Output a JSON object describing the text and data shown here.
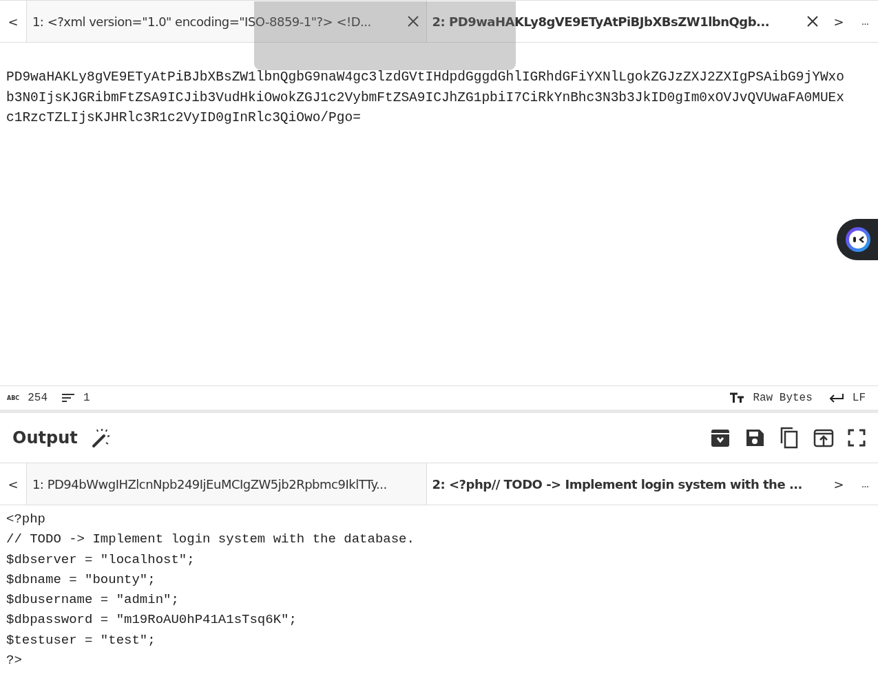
{
  "input": {
    "tabs": [
      {
        "label": "1: <?xml version=\"1.0\" encoding=\"ISO-8859-1\"?> <!D...",
        "selected": false
      },
      {
        "label": "2: PD9waHAKLy8gVE9ETyAtPiBJbXBsZW1lbnQgb...",
        "selected": true
      }
    ],
    "prev": "<",
    "next": ">",
    "more": "...",
    "text": "PD9waHAKLy8gVE9ETyAtPiBJbXBsZW1lbnQgbG9naW4gc3lzdGVtIHdpdGggdGhlIGRhdGFiYXNlLgokZGJzZXJ2ZXIgPSAibG9jYWxob3N0IjsKJGRibmFtZSA9ICJib3VudHkiOwokZGJ1c2VybmFtZSA9ICJhZG1pbiI7CiRkYnBhc3N3b3JkID0gIm0xOVJvQVUwaFA0MUExc1RzcTZLIjsKJHRlc3R1c2VyID0gInRlc3QiOwo/Pgo="
  },
  "status": {
    "length_icon": "ABC",
    "length": "254",
    "lines": "1",
    "encoding": "Raw Bytes",
    "eol": "LF"
  },
  "output": {
    "title": "Output",
    "tabs": [
      {
        "label": "1: PD94bWwgIHZlcnNpb249IjEuMCIgZW5jb2Rpbmc9IklTTy...",
        "selected": false
      },
      {
        "label": "2: <?php// TODO -> Implement login system with the ...",
        "selected": true
      }
    ],
    "prev": "<",
    "next": ">",
    "more": "...",
    "lines": [
      "<?php",
      "// TODO -> Implement login system with the database.",
      "$dbserver = \"localhost\";",
      "$dbname = \"bounty\";",
      "$dbusername = \"admin\";",
      "$dbpassword = \"m19RoAU0hP41A1sTsq6K\";",
      "$testuser = \"test\";",
      "?>"
    ]
  }
}
